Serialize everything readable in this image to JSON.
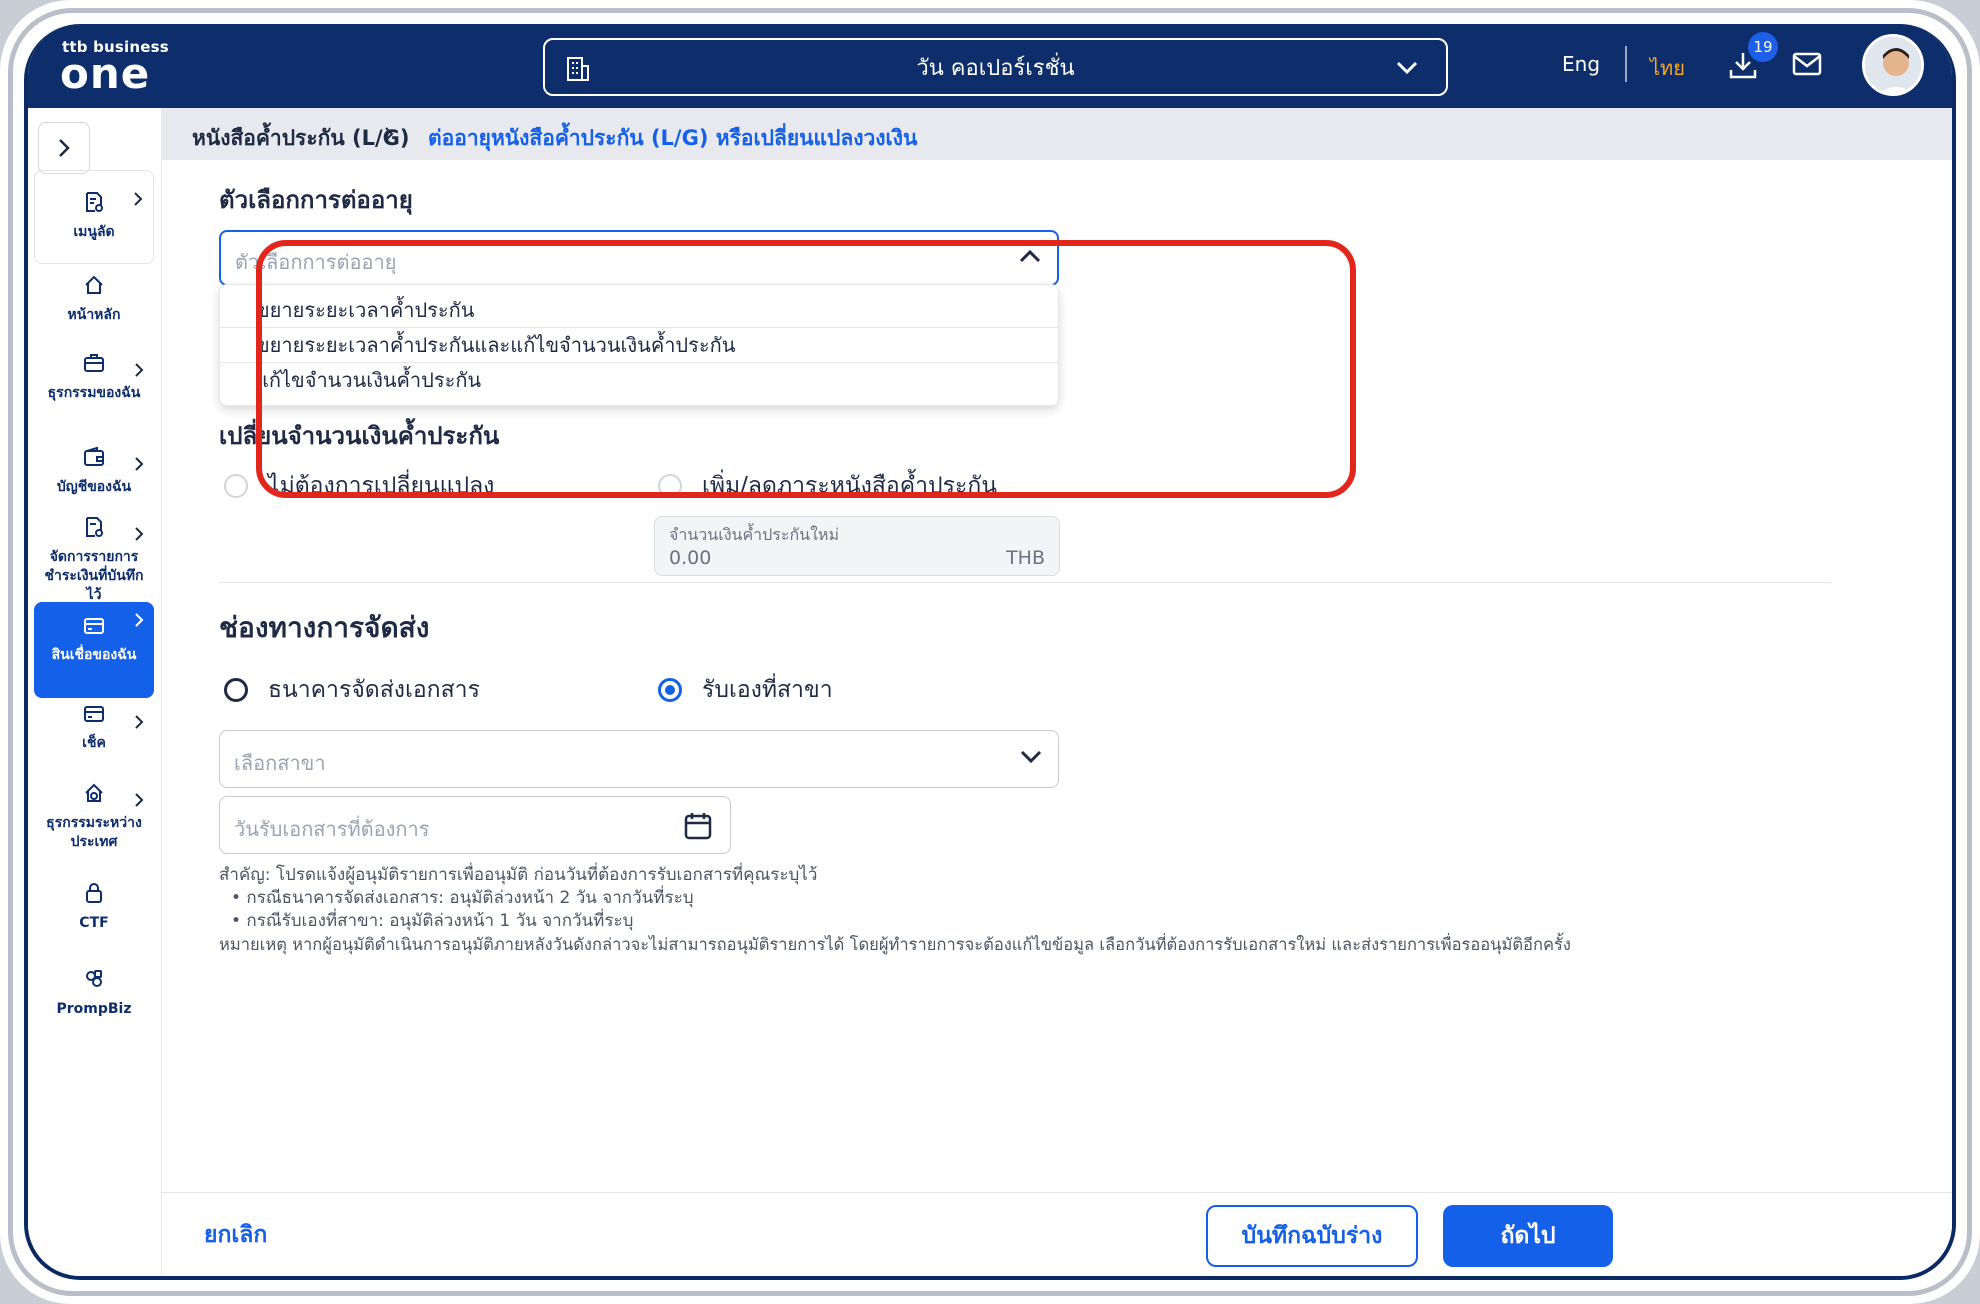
{
  "header": {
    "logo_small": "ttb business",
    "logo_big": "one",
    "company": "วัน คอเปอร์เรชั่น",
    "lang_en": "Eng",
    "lang_th": "ไทย",
    "download_badge": "19"
  },
  "sidebar": {
    "items": [
      {
        "label": "เมนูลัด"
      },
      {
        "label": "หน้าหลัก"
      },
      {
        "label": "ธุรกรรมของฉัน"
      },
      {
        "label": "บัญชีของฉัน"
      },
      {
        "label": "จัดการรายการชำระเงินที่บันทึกไว้"
      },
      {
        "label": "สินเชื่อของฉัน"
      },
      {
        "label": "เช็ค"
      },
      {
        "label": "ธุรกรรมระหว่างประเทศ"
      },
      {
        "label": "CTF"
      },
      {
        "label": "PrompBiz"
      }
    ]
  },
  "breadcrumb": {
    "level1": "หนังสือค้ำประกัน (L/G)",
    "level2": "ต่ออายุหนังสือค้ำประกัน (L/G) หรือเปลี่ยนแปลงวงเงิน"
  },
  "renewal": {
    "title": "ตัวเลือกการต่ออายุ",
    "placeholder": "ตัวเลือกการต่ออายุ",
    "options": [
      "ขยายระยะเวลาค้ำประกัน",
      "ขยายระยะเวลาค้ำประกันและแก้ไขจำนวนเงินค้ำประกัน",
      "แก้ไขจำนวนเงินค้ำประกัน"
    ]
  },
  "amount": {
    "title": "เปลี่ยนจำนวนเงินค้ำประกัน",
    "option_no_change": "ไม่ต้องการเปลี่ยนแปลง",
    "option_change": "เพิ่ม/ลดภาระหนังสือค้ำประกัน",
    "new_amount_label": "จำนวนเงินค้ำประกันใหม่",
    "new_amount_value": "0.00",
    "currency": "THB"
  },
  "delivery": {
    "title": "ช่องทางการจัดส่ง",
    "option_bank": "ธนาคารจัดส่งเอกสาร",
    "option_branch": "รับเองที่สาขา",
    "branch_placeholder": "เลือกสาขา",
    "date_placeholder": "วันรับเอกสารที่ต้องการ"
  },
  "notes": {
    "line1": "สำคัญ: โปรดแจ้งผู้อนุมัติรายการเพื่ออนุมัติ ก่อนวันที่ต้องการรับเอกสารที่คุณระบุไว้",
    "bullet1": "• กรณีธนาคารจัดส่งเอกสาร: อนุมัติล่วงหน้า 2 วัน จากวันที่ระบุ",
    "bullet2": "• กรณีรับเองที่สาขา: อนุมัติล่วงหน้า 1 วัน จากวันที่ระบุ",
    "line2": "หมายเหตุ หากผู้อนุมัติดำเนินการอนุมัติภายหลังวันดังกล่าวจะไม่สามารถอนุมัติรายการได้ โดยผู้ทำรายการจะต้องแก้ไขข้อมูล เลือกวันที่ต้องการรับเอกสารใหม่ และส่งรายการเพื่อรออนุมัติอีกครั้ง"
  },
  "footer": {
    "cancel": "ยกเลิก",
    "save_draft": "บันทึกฉบับร่าง",
    "next": "ถัดไป"
  },
  "colors": {
    "brand_navy": "#0d2d6b",
    "accent_blue": "#1560e8",
    "highlight_red": "#e3261b",
    "lang_active": "#f5a623"
  }
}
